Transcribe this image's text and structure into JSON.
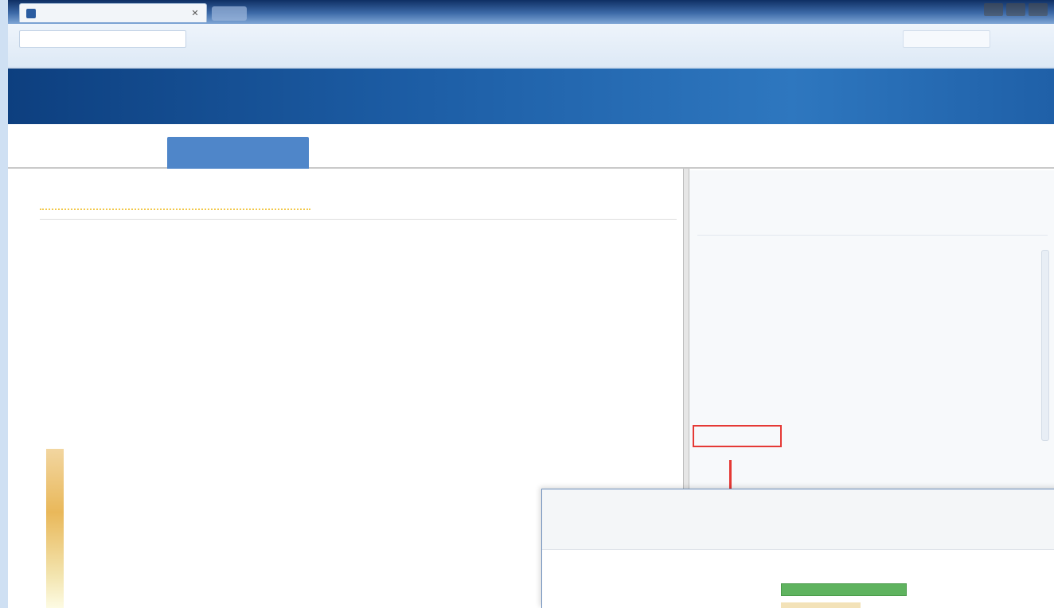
{
  "browser": {
    "tab_title": "",
    "url": "",
    "nav_buttons": [
      "",
      "",
      ""
    ]
  },
  "header": {
    "logo_text": "",
    "actions": [
      "",
      "",
      ""
    ]
  },
  "subnav": {
    "tabs": [
      "",
      "",
      ""
    ],
    "right_text": ""
  },
  "left": {
    "column_header": {
      "left": "",
      "middle": "",
      "right": ""
    },
    "rows": [
      {
        "main": "",
        "side": ""
      },
      {
        "main": "",
        "side": ""
      },
      {
        "main": "",
        "side": ""
      },
      {
        "main": "",
        "side": ""
      },
      {
        "main": "",
        "side": ""
      },
      {
        "main": "",
        "side": ""
      },
      {
        "main": "",
        "side": ""
      },
      {
        "main": "",
        "side": ""
      }
    ],
    "entries": [
      {
        "a": [
          "",
          "",
          ""
        ],
        "b": [
          "",
          "",
          ""
        ]
      },
      {
        "a": [
          "",
          ""
        ],
        "b": [
          "",
          "",
          ""
        ]
      },
      {
        "a": [
          "",
          ""
        ],
        "b": [
          "",
          ""
        ]
      }
    ]
  },
  "right": {
    "lines": [
      {
        "text": "",
        "num": ""
      },
      {
        "text": "",
        "num": ""
      },
      {
        "text": "",
        "num": ""
      },
      {
        "text": "",
        "num": ""
      },
      {
        "text": "",
        "num": ""
      },
      {
        "text": "",
        "num": ""
      },
      {
        "text": "",
        "num": ""
      },
      {
        "text": "",
        "num": ""
      },
      {
        "text": "",
        "num": ""
      }
    ],
    "highlight_label": "",
    "footer_line": ""
  },
  "inset": {
    "tab_label": "",
    "label_a": "",
    "label_b": ""
  },
  "colors": {
    "brand_blue": "#1d5ea6",
    "active_tab": "#4f86c9",
    "annotation_red": "#e53935",
    "bar_green": "#5fb35f"
  }
}
